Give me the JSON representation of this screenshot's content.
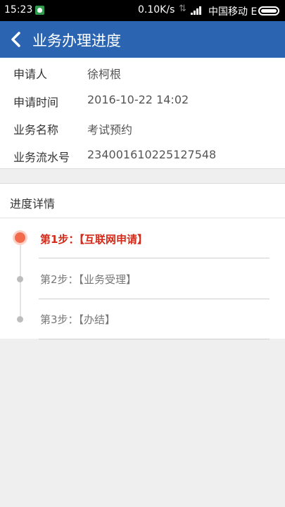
{
  "status_bar": {
    "time": "15:23",
    "net_speed": "0.10K/s",
    "carrier": "中国移动 E",
    "icons": [
      "notification-icon",
      "data-arrows-icon",
      "signal-icon",
      "battery-icon"
    ]
  },
  "header": {
    "title": "业务办理进度",
    "back_icon": "back-chevron-icon",
    "color": "#2b65b2"
  },
  "info": {
    "rows": [
      {
        "label": "申请人",
        "value": "徐柯根"
      },
      {
        "label": "申请时间",
        "value": "2016-10-22 14:02"
      },
      {
        "label": "业务名称",
        "value": "考试预约"
      },
      {
        "label": "业务流水号",
        "value": "234001610225127548"
      }
    ]
  },
  "progress": {
    "title": "进度详情",
    "steps": [
      {
        "label": "第1步：【互联网申请】",
        "active": true
      },
      {
        "label": "第2步：【业务受理】",
        "active": false
      },
      {
        "label": "第3步：【办结】",
        "active": false
      }
    ],
    "active_color": "#d32a1a",
    "dot_color": "#f36b4d"
  }
}
